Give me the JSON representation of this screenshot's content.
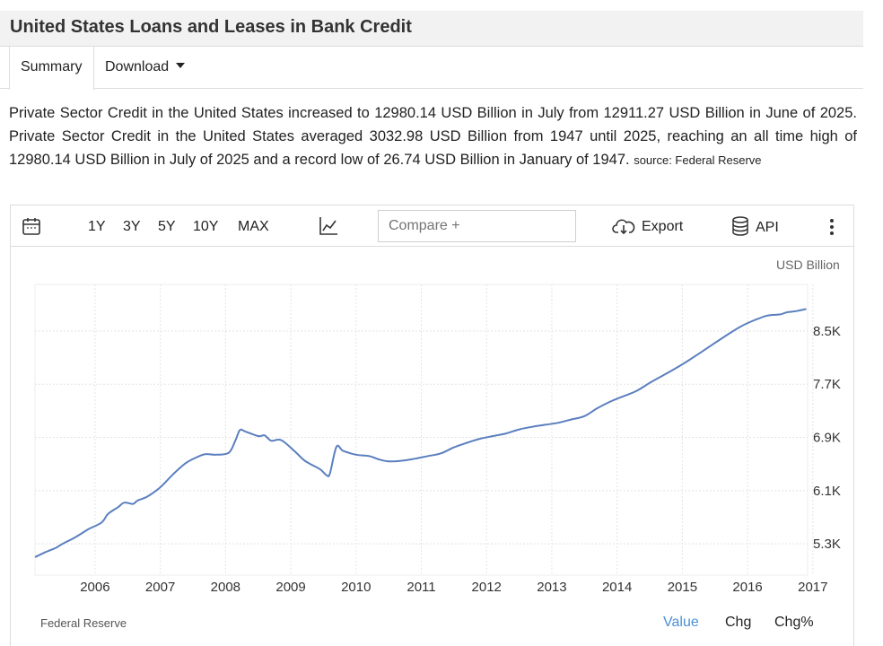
{
  "header": {
    "title": "United States Loans and Leases in Bank Credit"
  },
  "tabs": {
    "summary": "Summary",
    "download": "Download"
  },
  "description": {
    "text": "Private Sector Credit in the United States increased to 12980.14 USD Billion in July from 12911.27 USD Billion in June of 2025. Private Sector Credit in the United States averaged 3032.98 USD Billion from 1947 until 2025, reaching an all time high of 12980.14 USD Billion in July of 2025 and a record low of 26.74 USD Billion in January of 1947.",
    "source": "source: Federal Reserve"
  },
  "toolbar": {
    "ranges": [
      "1Y",
      "3Y",
      "5Y",
      "10Y",
      "MAX"
    ],
    "compare_placeholder": "Compare +",
    "export_label": "Export",
    "api_label": "API"
  },
  "chart_data": {
    "type": "line",
    "unit_label": "USD Billion",
    "x_ticks": [
      "2006",
      "2007",
      "2008",
      "2009",
      "2010",
      "2011",
      "2012",
      "2013",
      "2014",
      "2015",
      "2016",
      "2017"
    ],
    "y_ticks": [
      "5.3K",
      "6.1K",
      "6.9K",
      "7.7K",
      "8.5K"
    ],
    "y_tick_values": [
      5300,
      6100,
      6900,
      7700,
      8500
    ],
    "xlim": [
      2005.58,
      2017.42
    ],
    "ylim": [
      4830,
      9200
    ],
    "grid": true,
    "series": [
      {
        "color": "#5b7fbf",
        "x": [
          2005.58,
          2005.75,
          2005.9,
          2006.0,
          2006.2,
          2006.4,
          2006.6,
          2006.7,
          2006.85,
          2006.95,
          2007.08,
          2007.15,
          2007.3,
          2007.5,
          2007.7,
          2007.9,
          2008.1,
          2008.2,
          2008.35,
          2008.55,
          2008.65,
          2008.72,
          2008.8,
          2009.0,
          2009.1,
          2009.2,
          2009.35,
          2009.55,
          2009.7,
          2009.8,
          2009.95,
          2010.05,
          2010.1,
          2010.2,
          2010.3,
          2010.5,
          2010.7,
          2010.85,
          2011.0,
          2011.2,
          2011.4,
          2011.6,
          2011.8,
          2012.0,
          2012.2,
          2012.4,
          2012.6,
          2012.8,
          2013.0,
          2013.2,
          2013.4,
          2013.6,
          2013.8,
          2014.0,
          2014.2,
          2014.4,
          2014.6,
          2014.8,
          2015.0,
          2015.2,
          2015.4,
          2015.6,
          2015.8,
          2016.0,
          2016.2,
          2016.4,
          2016.6,
          2016.8,
          2017.0,
          2017.1,
          2017.25,
          2017.4
        ],
        "values": [
          5100,
          5180,
          5240,
          5300,
          5400,
          5520,
          5620,
          5750,
          5850,
          5920,
          5900,
          5950,
          6010,
          6150,
          6350,
          6520,
          6620,
          6650,
          6640,
          6670,
          6850,
          7010,
          6990,
          6920,
          6930,
          6850,
          6860,
          6700,
          6560,
          6500,
          6420,
          6330,
          6360,
          6760,
          6700,
          6640,
          6620,
          6570,
          6540,
          6550,
          6580,
          6620,
          6660,
          6750,
          6820,
          6880,
          6920,
          6960,
          7020,
          7060,
          7090,
          7120,
          7170,
          7220,
          7340,
          7440,
          7520,
          7600,
          7720,
          7830,
          7940,
          8060,
          8190,
          8320,
          8450,
          8570,
          8660,
          8730,
          8750,
          8780,
          8800,
          8830
        ]
      }
    ],
    "source_label": "Federal Reserve",
    "modes": [
      "Value",
      "Chg",
      "Chg%"
    ],
    "active_mode": "Value"
  }
}
